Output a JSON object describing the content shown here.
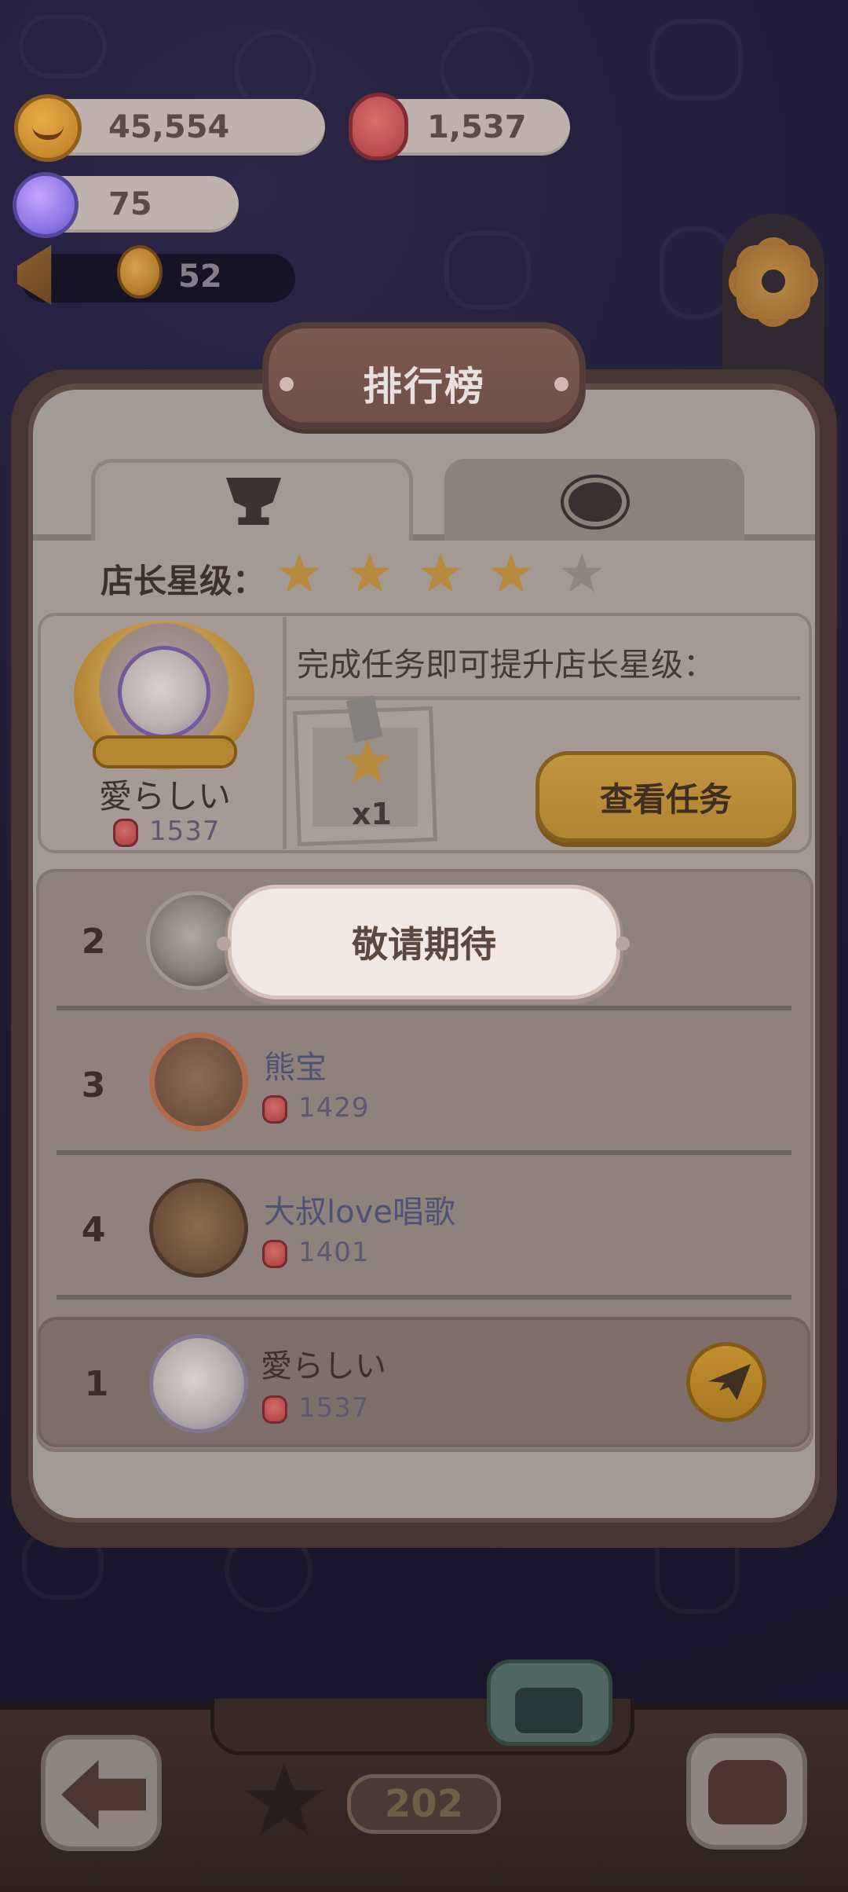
{
  "hud": {
    "coins": "45,554",
    "berries": "1,537",
    "candies": "75",
    "news_count": "52"
  },
  "panel": {
    "title": "排行榜",
    "tabs": [
      {
        "icon": "trophy-icon",
        "active": true
      },
      {
        "icon": "planet-icon",
        "active": false
      }
    ],
    "star_label": "店长星级：",
    "stars_filled": 4,
    "stars_total": 5
  },
  "profile": {
    "name": "愛らしい",
    "score": "1537",
    "task_text": "完成任务即可提升店长星级：",
    "reward_count": "x1",
    "button_label": "查看任务"
  },
  "ranking": {
    "rows": [
      {
        "rank": "2",
        "name": "",
        "score": ""
      },
      {
        "rank": "3",
        "name": "熊宝",
        "score": "1429"
      },
      {
        "rank": "4",
        "name": "大叔love唱歌",
        "score": "1401"
      }
    ],
    "current_user": {
      "rank": "1",
      "name": "愛らしい",
      "score": "1537"
    }
  },
  "overlay": {
    "text": "敬请期待"
  },
  "bottom": {
    "level": "202"
  },
  "colors": {
    "background": "#1f1a35",
    "panel": "#a39a95",
    "accent": "#b88a3e",
    "overlay": "#f2e7e4"
  }
}
